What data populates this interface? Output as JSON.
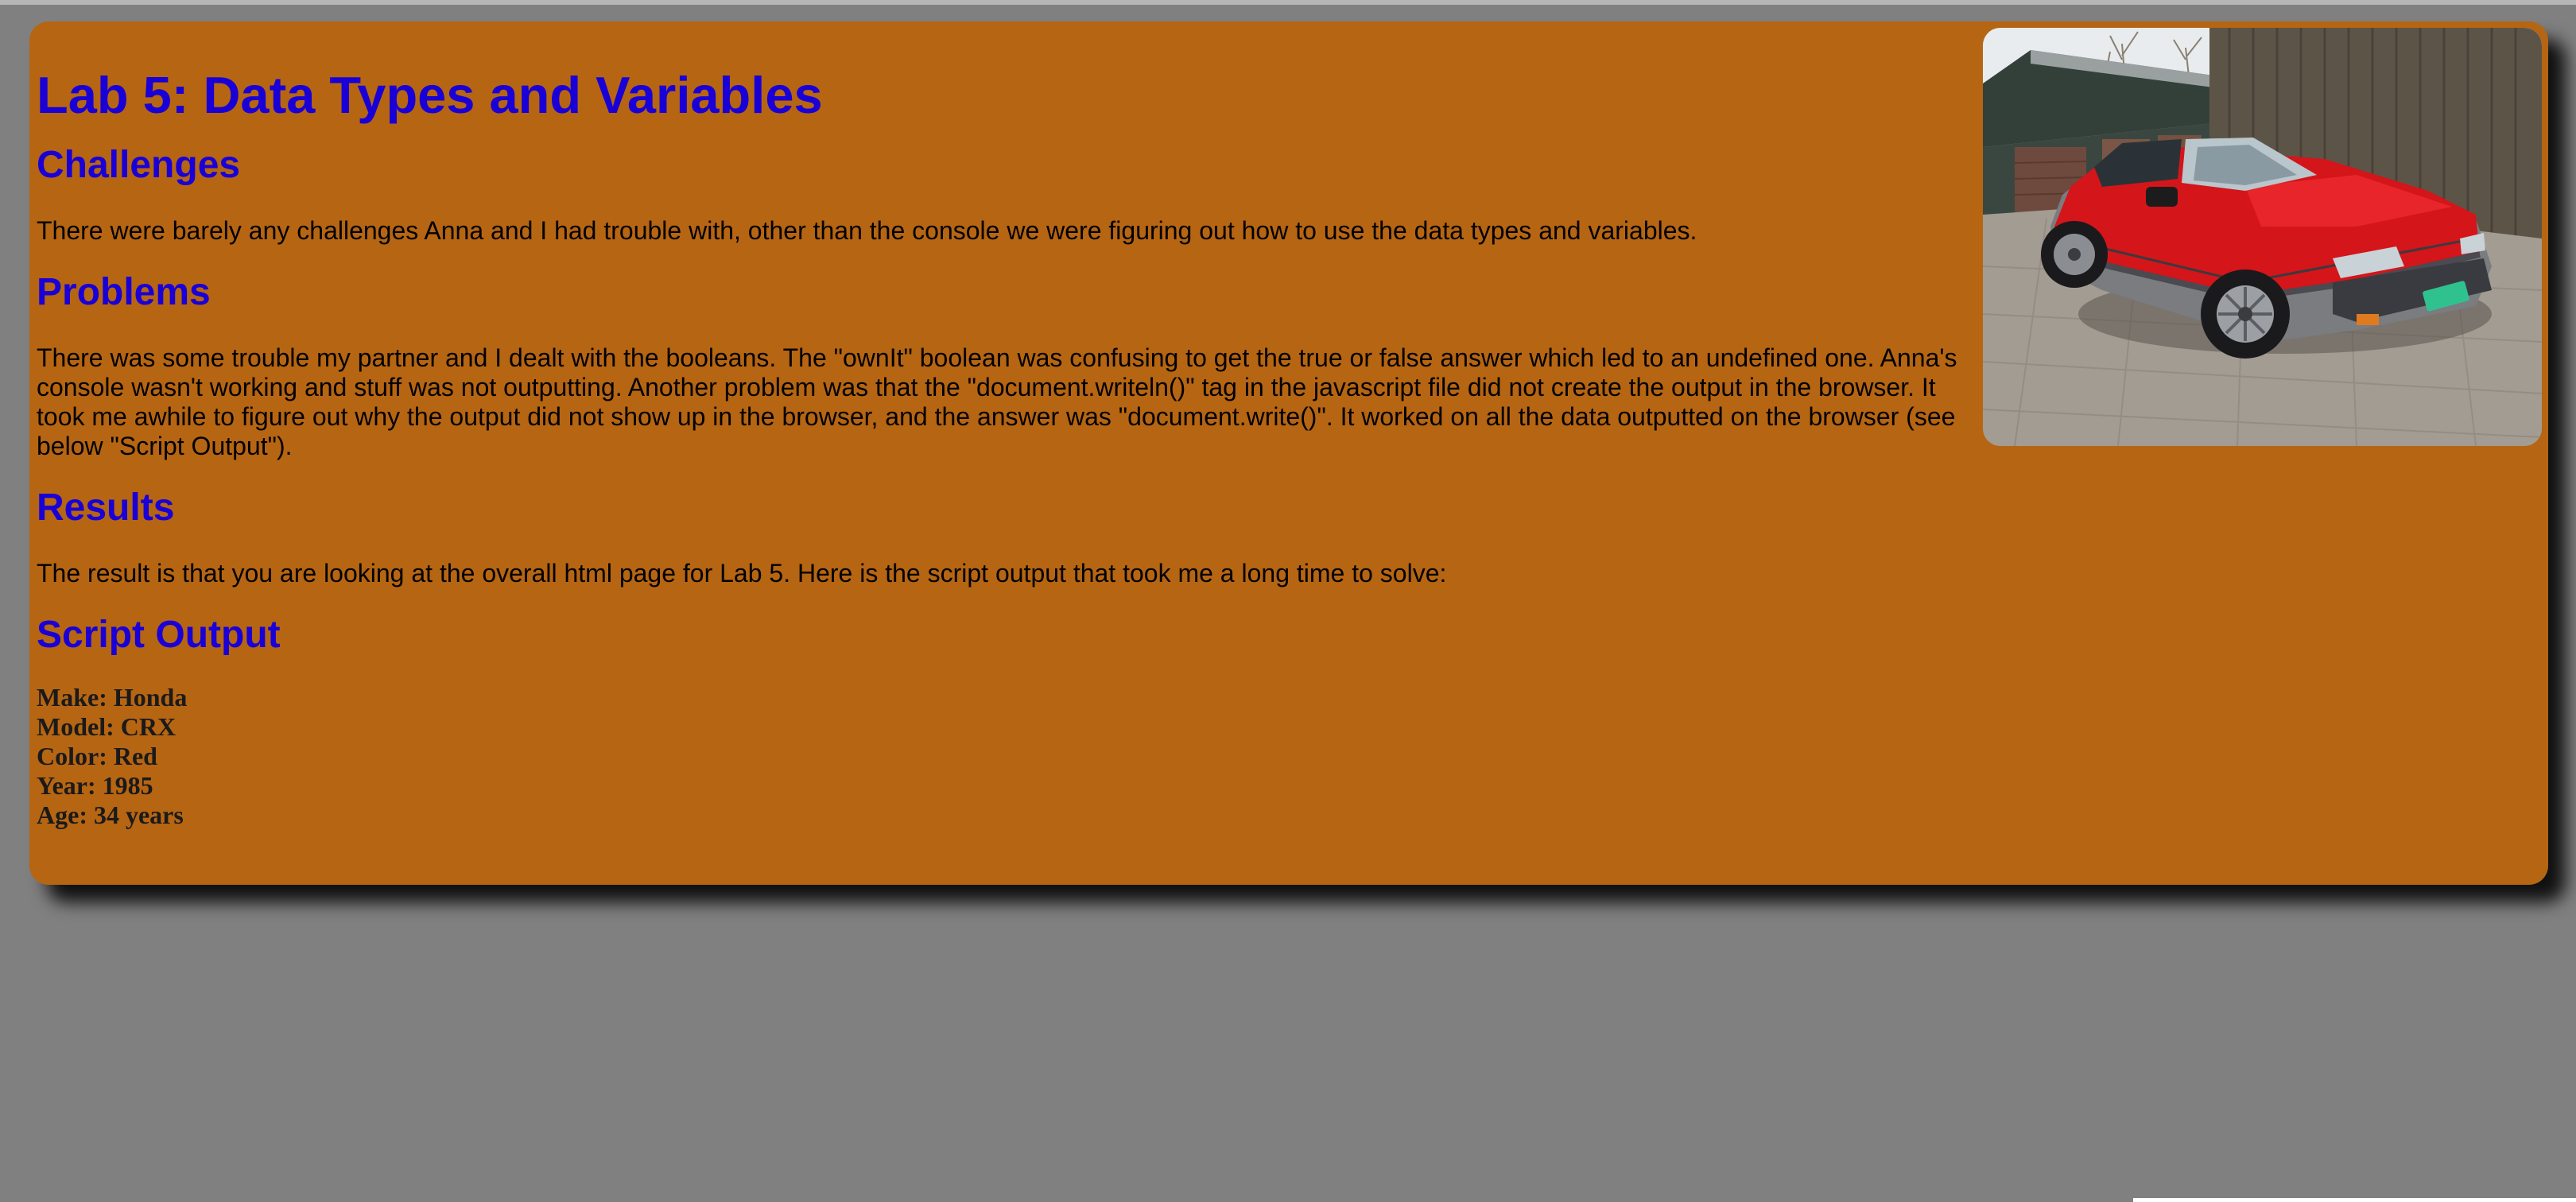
{
  "lab": {
    "title": "Lab 5: Data Types and Variables"
  },
  "sections": {
    "challenges": {
      "heading": "Challenges",
      "body": "There were barely any challenges Anna and I had trouble with, other than the console we were figuring out how to use the data types and variables."
    },
    "problems": {
      "heading": "Problems",
      "body": "There was some trouble my partner and I dealt with the booleans. The \"ownIt\" boolean was confusing to get the true or false answer which led to an undefined one. Anna's console wasn't working and stuff was not outputting. Another problem was that the \"document.writeln()\" tag in the javascript file did not create the output in the browser. It took me awhile to figure out why the output did not show up in the browser, and the answer was \"document.write()\". It worked on all the data outputted on the browser (see below \"Script Output\")."
    },
    "results": {
      "heading": "Results",
      "body": "The result is that you are looking at the overall html page for Lab 5. Here is the script output that took me a long time to solve:"
    },
    "script_output": {
      "heading": "Script Output",
      "lines": [
        "Make: Honda",
        "Model: CRX",
        "Color: Red",
        "Year: 1985",
        "Age: 34 years"
      ]
    }
  },
  "image": {
    "subject": "red-honda-crx-photo"
  },
  "colors": {
    "page_background": "#808080",
    "card_background": "#b66513",
    "heading_color": "#1900d6",
    "text_color": "#000000"
  }
}
